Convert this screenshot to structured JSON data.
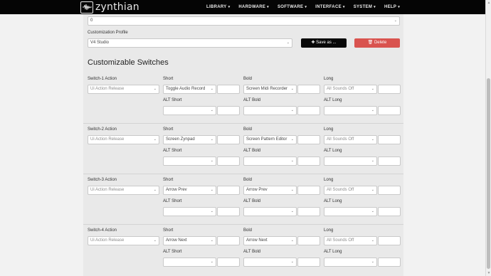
{
  "nav": {
    "logo_text": "zynthian",
    "items": [
      "LIBRARY",
      "HARDWARE",
      "SOFTWARE",
      "INTERFACE",
      "SYSTEM",
      "HELP"
    ],
    "caret": "▾"
  },
  "form": {
    "top_select_value": "0",
    "profile_label": "Customization Profile",
    "profile_value": "V4 Studio",
    "save_label": "✚ Save as ...",
    "delete_label": "🗑 Delete",
    "section_title": "Customizable Switches",
    "field_labels": {
      "short": "Short",
      "bold": "Bold",
      "long": "Long",
      "alt_short": "ALT Short",
      "alt_bold": "ALT Bold",
      "alt_long": "ALT Long"
    },
    "switches": [
      {
        "label": "Switch-1 Action",
        "action": "Ui Action Release",
        "short": "Toggle Audio Record",
        "bold": "Screen Midi Recorder",
        "long": "All Sounds Off"
      },
      {
        "label": "Switch-2 Action",
        "action": "Ui Action Release",
        "short": "Screen Zynpad",
        "bold": "Screen Pattern Editor",
        "long": "All Sounds Off"
      },
      {
        "label": "Switch-3 Action",
        "action": "Ui Action Release",
        "short": "Arrow Prev",
        "bold": "Arrow Prev",
        "long": "All Sounds Off"
      },
      {
        "label": "Switch-4 Action",
        "action": "Ui Action Release",
        "short": "Arrow Next",
        "bold": "Arrow Next",
        "long": "All Sounds Off"
      }
    ]
  },
  "icons": {
    "chevron": "⌄",
    "scroll_up": "▲",
    "scroll_down": "▼"
  },
  "colors": {
    "navbar": "#050505",
    "save_button": "#080808",
    "delete_button": "#d9534f",
    "panel": "#e9e9e9"
  }
}
